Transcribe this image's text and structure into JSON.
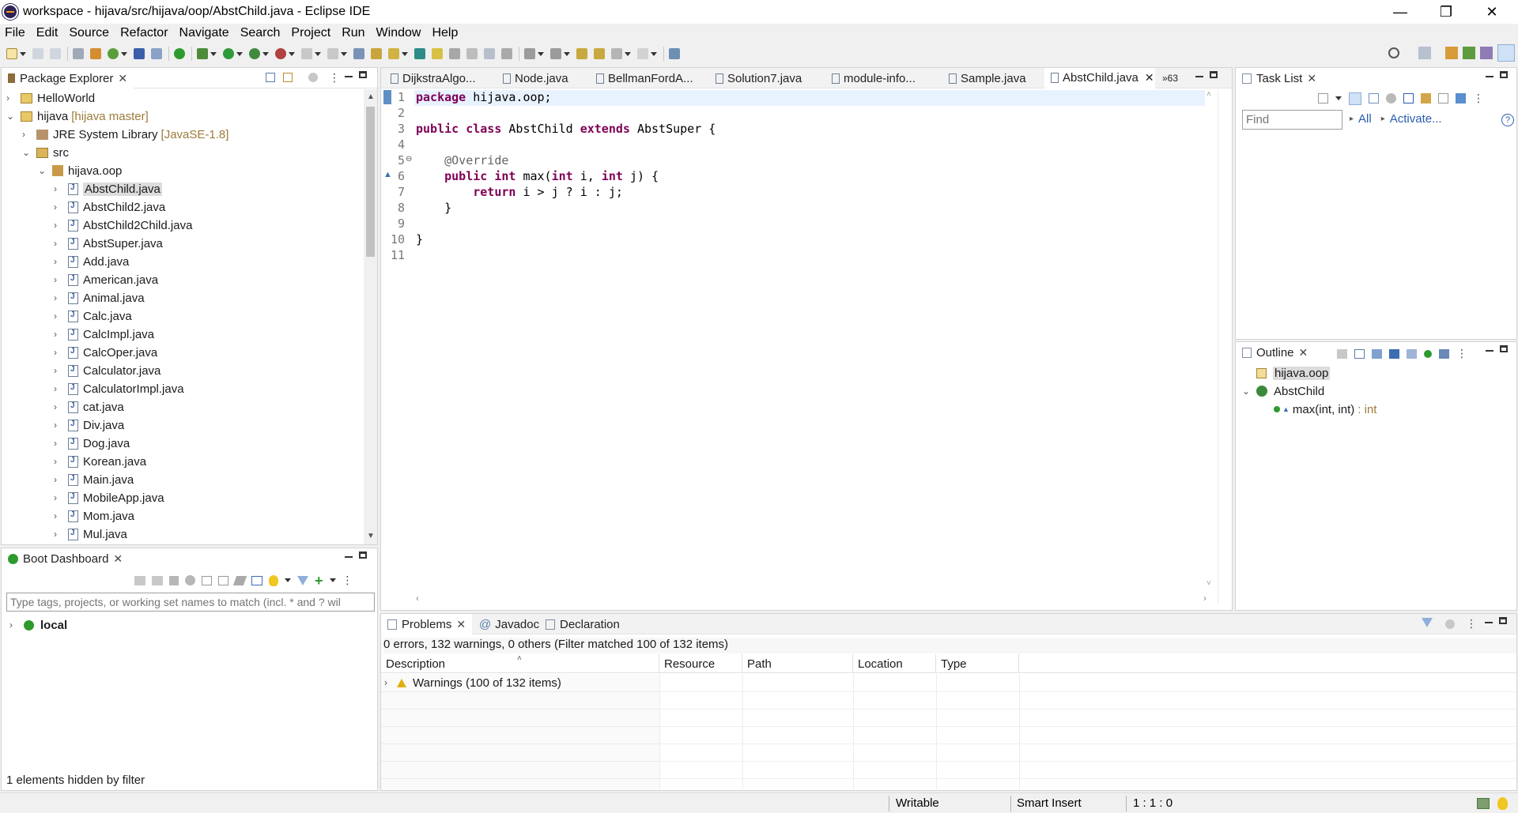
{
  "window": {
    "title": "workspace - hijava/src/hijava/oop/AbstChild.java - Eclipse IDE",
    "minimize": "—",
    "restore": "❐",
    "close": "✕"
  },
  "menu": [
    "File",
    "Edit",
    "Source",
    "Refactor",
    "Navigate",
    "Search",
    "Project",
    "Run",
    "Window",
    "Help"
  ],
  "package_explorer": {
    "title": "Package Explorer",
    "items": [
      {
        "label": "HelloWorld",
        "deco": ""
      },
      {
        "label": "hijava",
        "deco": "[hijava master]"
      },
      {
        "label": "JRE System Library",
        "deco": "[JavaSE-1.8]"
      },
      {
        "label": "src",
        "deco": ""
      },
      {
        "label": "hijava.oop",
        "deco": ""
      }
    ],
    "files": [
      "AbstChild.java",
      "AbstChild2.java",
      "AbstChild2Child.java",
      "AbstSuper.java",
      "Add.java",
      "American.java",
      "Animal.java",
      "Calc.java",
      "CalcImpl.java",
      "CalcOper.java",
      "Calculator.java",
      "CalculatorImpl.java",
      "cat.java",
      "Div.java",
      "Dog.java",
      "Korean.java",
      "Main.java",
      "MobileApp.java",
      "Mom.java",
      "Mul.java"
    ]
  },
  "boot_dashboard": {
    "title": "Boot Dashboard",
    "filter_placeholder": "Type tags, projects, or working set names to match (incl. * and ? wil",
    "local": "local",
    "hidden_note": "1 elements hidden by filter"
  },
  "editor": {
    "tabs": [
      "DijkstraAlgo...",
      "Node.java",
      "BellmanFordA...",
      "Solution7.java",
      "module-info...",
      "Sample.java",
      "AbstChild.java"
    ],
    "overflow_count": "»63",
    "line_numbers": [
      "1",
      "2",
      "3",
      "4",
      "5",
      "6",
      "7",
      "8",
      "9",
      "10",
      "11"
    ]
  },
  "task_list": {
    "title": "Task List",
    "find_placeholder": "Find",
    "all": "All",
    "activate": "Activate...",
    "help": "?"
  },
  "outline": {
    "title": "Outline",
    "package": "hijava.oop",
    "class": "AbstChild",
    "method": "max(int, int)",
    "method_type": ": int"
  },
  "problems": {
    "tabs": [
      "Problems",
      "Javadoc",
      "Declaration"
    ],
    "summary": "0 errors, 132 warnings, 0 others (Filter matched 100 of 132 items)",
    "columns": [
      "Description",
      "Resource",
      "Path",
      "Location",
      "Type"
    ],
    "rows": [
      {
        "description": "Warnings (100 of 132 items)"
      }
    ]
  },
  "status": {
    "mode": "Writable",
    "insert": "Smart Insert",
    "position": "1 : 1 : 0"
  }
}
